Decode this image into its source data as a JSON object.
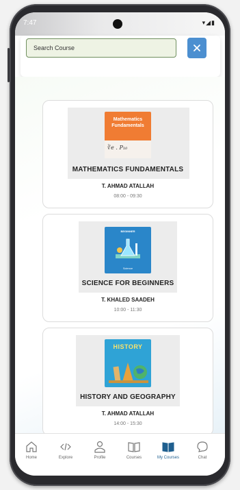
{
  "status_bar": {
    "time": "7:47",
    "icons": "▾◢▮"
  },
  "search": {
    "placeholder": "Search Course",
    "value": ""
  },
  "courses": [
    {
      "title": "MATHEMATICS FUNDAMENTALS",
      "teacher": "T. AHMAD ATALLAH",
      "time": "08:00 - 09:30",
      "thumb_text": "Mathematics Fundamentals",
      "thumb_formula": "∛e . P₁₀",
      "thumb_color": "#f07c33"
    },
    {
      "title": "SCIENCE FOR BEGINNERS",
      "teacher": "T. KHALED SAADEH",
      "time": "10:00 - 11:30",
      "thumb_top": "BEGINNER",
      "thumb_bottom": "Science",
      "thumb_color": "#2a86c9"
    },
    {
      "title": "HISTORY AND GEOGRAPHY",
      "teacher": "T. AHMAD ATALLAH",
      "time": "14:00 - 15:30",
      "thumb_text": "HISTORY",
      "thumb_color": "#2fa3d6"
    }
  ],
  "nav": [
    {
      "label": "Home",
      "icon": "home-icon"
    },
    {
      "label": "Explore",
      "icon": "code-icon"
    },
    {
      "label": "Profile",
      "icon": "person-icon"
    },
    {
      "label": "Courses",
      "icon": "open-book-icon"
    },
    {
      "label": "My Courses",
      "icon": "book-filled-icon",
      "active": true
    },
    {
      "label": "Chat",
      "icon": "chat-bubble-icon"
    }
  ],
  "colors": {
    "accent": "#4c8fd0",
    "active_nav": "#1f5f8f",
    "search_border": "#6f8f5e"
  }
}
